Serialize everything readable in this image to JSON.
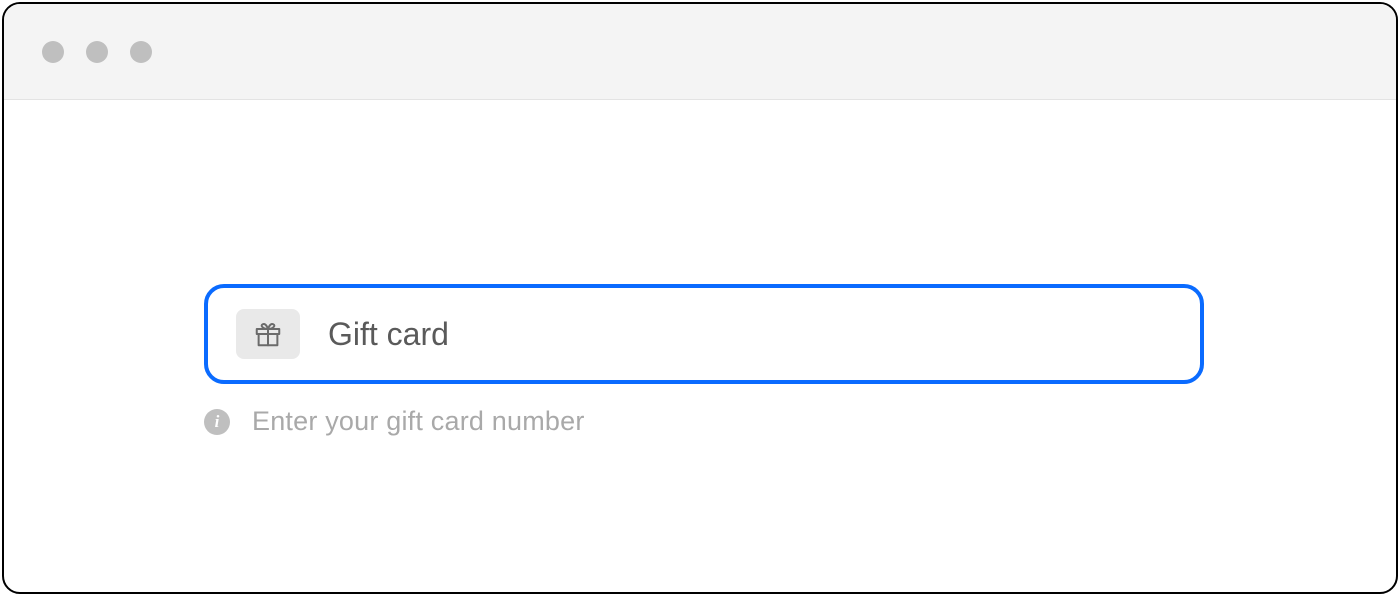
{
  "input": {
    "placeholder": "Gift card",
    "value": ""
  },
  "helper": {
    "text": "Enter your gift card number"
  }
}
